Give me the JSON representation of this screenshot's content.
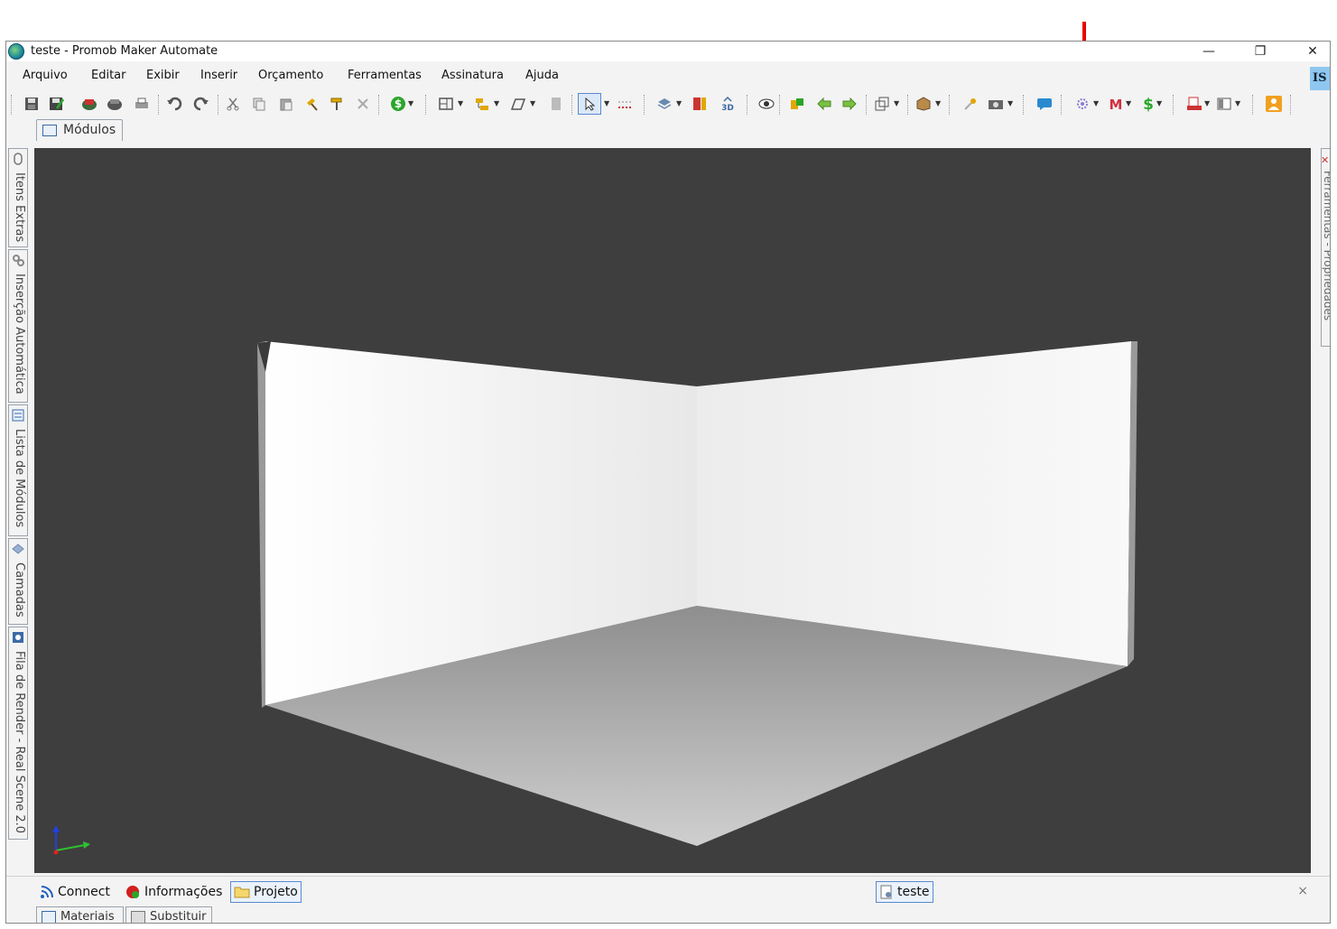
{
  "window": {
    "title": "teste - Promob Maker Automate",
    "minimize": "—",
    "maximize": "❐",
    "close": "✕"
  },
  "menu": [
    "Arquivo",
    "Editar",
    "Exibir",
    "Inserir",
    "Orçamento",
    "Ferramentas",
    "Assinatura",
    "Ajuda"
  ],
  "menu_badge": "IS",
  "tabs": {
    "modulos": "Módulos"
  },
  "left_panel": [
    "Itens Extras",
    "Inserção Automática",
    "Lista de Módulos",
    "Camadas",
    "Fila de Render - Real Scene 2.0"
  ],
  "right_panel": "Ferramentas - Propriedades",
  "bottom_tabs": [
    "Connect",
    "Informações",
    "Projeto"
  ],
  "document_tab": "teste",
  "bottom_close": "×",
  "bottom_tabs_2": [
    "Materiais",
    "Substituir"
  ],
  "colors": {
    "viewport_bg": "#3e3e3e",
    "arrow": "#e60000",
    "accent": "#5a8ad0"
  }
}
